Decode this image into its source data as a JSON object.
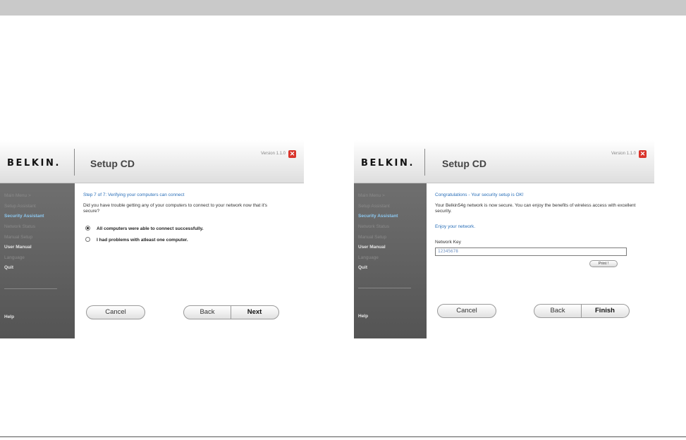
{
  "screens": [
    {
      "logo": "BELKIN.",
      "app_title": "Setup CD",
      "version": "Version 1.1.0",
      "close_glyph": "✕",
      "sidebar": {
        "items": [
          {
            "label": "Main Menu  >"
          },
          {
            "label": "Setup Assistant"
          },
          {
            "label": "Security Assistant"
          },
          {
            "label": "Network Status"
          },
          {
            "label": "Manual Setup"
          },
          {
            "label": "User Manual"
          },
          {
            "label": "Language"
          },
          {
            "label": "Quit"
          }
        ],
        "help": "Help"
      },
      "step_title": "Step 7 of 7: Verifying your computers can connect",
      "question": "Did you have trouble getting any of your computers to connect to your network now that it's secure?",
      "options": [
        {
          "label": "All computers were able to connect successfully.",
          "selected": true
        },
        {
          "label": "I had problems with atleast one computer.",
          "selected": false
        }
      ],
      "buttons": {
        "cancel": "Cancel",
        "back": "Back",
        "next": "Next"
      }
    },
    {
      "logo": "BELKIN.",
      "app_title": "Setup CD",
      "version": "Version 1.1.0",
      "close_glyph": "✕",
      "sidebar": {
        "items": [
          {
            "label": "Main Menu  >"
          },
          {
            "label": "Setup Assistant"
          },
          {
            "label": "Security Assistant"
          },
          {
            "label": "Network Status"
          },
          {
            "label": "Manual Setup"
          },
          {
            "label": "User Manual"
          },
          {
            "label": "Language"
          },
          {
            "label": "Quit"
          }
        ],
        "help": "Help"
      },
      "step_title": "Congratulations - Your security setup is OK!",
      "message": "Your Belkin54g network is now secure. You can enjoy the benefits of wireless access with excellent security.",
      "enjoy": "Enjoy your network.",
      "key_label": "Network Key",
      "key_value": "12345678",
      "print_label": "Print !",
      "buttons": {
        "cancel": "Cancel",
        "back": "Back",
        "finish": "Finish"
      }
    }
  ]
}
